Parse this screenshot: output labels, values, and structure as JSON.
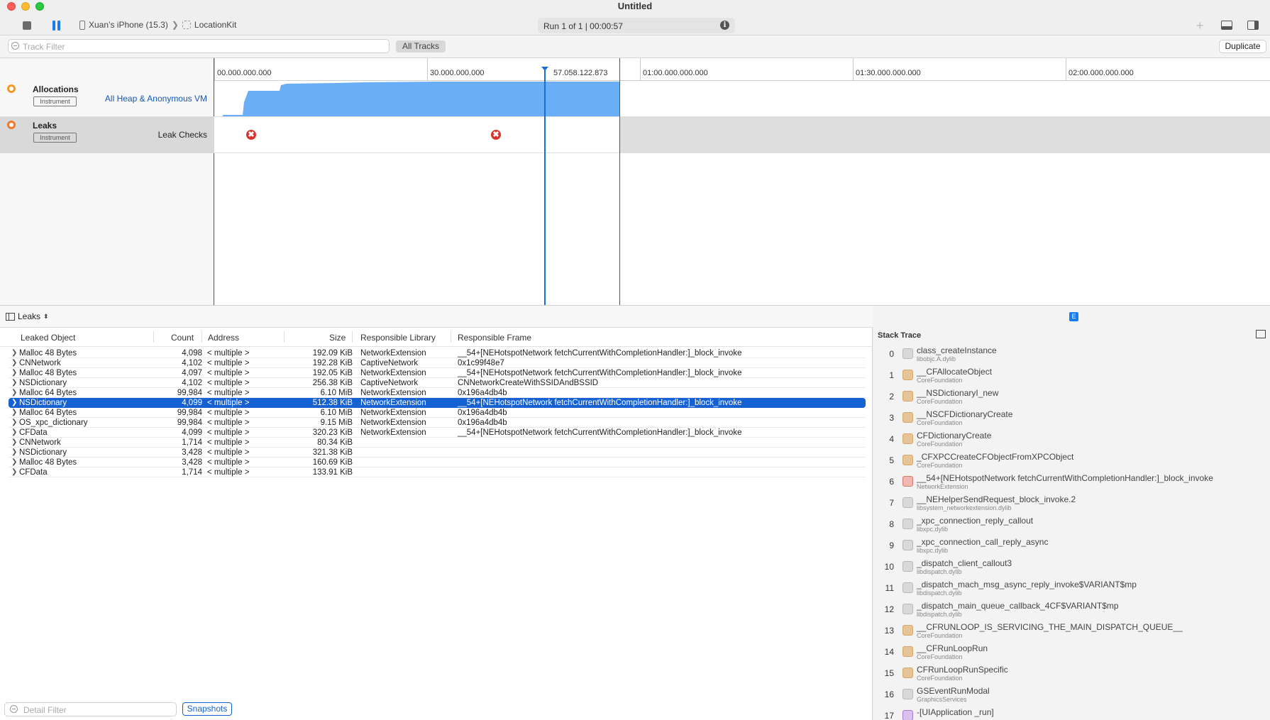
{
  "window": {
    "title": "Untitled"
  },
  "toolbar": {
    "device": "Xuan’s iPhone (15.3)",
    "app": "LocationKit",
    "run_info": "Run 1 of 1  |  00:00:57"
  },
  "filterbar": {
    "track_filter_placeholder": "Track Filter",
    "all_tracks_label": "All Tracks",
    "duplicate_label": "Duplicate"
  },
  "ruler": {
    "ticks": [
      "00.000.000.000",
      "30.000.000.000",
      "57.058.122.873",
      "01:00.000.000.000",
      "01:30.000.000.000",
      "02:00.000.000.000"
    ]
  },
  "tracks": [
    {
      "name": "Allocations",
      "badge": "Instrument",
      "subtitle": "All Heap & Anonymous VM"
    },
    {
      "name": "Leaks",
      "badge": "Instrument",
      "subtitle": "Leak Checks"
    }
  ],
  "leak_marker_glyph": "✖",
  "jumpbar": {
    "label": "Leaks"
  },
  "table": {
    "headers": {
      "object": "Leaked Object",
      "count": "Count",
      "address": "Address",
      "size": "Size",
      "library": "Responsible Library",
      "frame": "Responsible Frame"
    },
    "rows": [
      {
        "object": "Malloc 48 Bytes",
        "count": "4,098",
        "address": "< multiple >",
        "size": "192.09 KiB",
        "library": "NetworkExtension",
        "frame": "__54+[NEHotspotNetwork fetchCurrentWithCompletionHandler:]_block_invoke"
      },
      {
        "object": "CNNetwork",
        "count": "4,102",
        "address": "< multiple >",
        "size": "192.28 KiB",
        "library": "CaptiveNetwork",
        "frame": "0x1c99f48e7"
      },
      {
        "object": "Malloc 48 Bytes",
        "count": "4,097",
        "address": "< multiple >",
        "size": "192.05 KiB",
        "library": "NetworkExtension",
        "frame": "__54+[NEHotspotNetwork fetchCurrentWithCompletionHandler:]_block_invoke"
      },
      {
        "object": "NSDictionary",
        "count": "4,102",
        "address": "< multiple >",
        "size": "256.38 KiB",
        "library": "CaptiveNetwork",
        "frame": "CNNetworkCreateWithSSIDAndBSSID"
      },
      {
        "object": "Malloc 64 Bytes",
        "count": "99,984",
        "address": "< multiple >",
        "size": "6.10 MiB",
        "library": "NetworkExtension",
        "frame": "0x196a4db4b"
      },
      {
        "object": "NSDictionary",
        "count": "4,099",
        "address": "< multiple >",
        "size": "512.38 KiB",
        "library": "NetworkExtension",
        "frame": "__54+[NEHotspotNetwork fetchCurrentWithCompletionHandler:]_block_invoke"
      },
      {
        "object": "Malloc 64 Bytes",
        "count": "99,984",
        "address": "< multiple >",
        "size": "6.10 MiB",
        "library": "NetworkExtension",
        "frame": "0x196a4db4b"
      },
      {
        "object": "OS_xpc_dictionary",
        "count": "99,984",
        "address": "< multiple >",
        "size": "9.15 MiB",
        "library": "NetworkExtension",
        "frame": "0x196a4db4b"
      },
      {
        "object": "CFData",
        "count": "4,099",
        "address": "< multiple >",
        "size": "320.23 KiB",
        "library": "NetworkExtension",
        "frame": "__54+[NEHotspotNetwork fetchCurrentWithCompletionHandler:]_block_invoke"
      },
      {
        "object": "CNNetwork",
        "count": "1,714",
        "address": "< multiple >",
        "size": "80.34 KiB",
        "library": "",
        "frame": ""
      },
      {
        "object": "NSDictionary",
        "count": "3,428",
        "address": "< multiple >",
        "size": "321.38 KiB",
        "library": "",
        "frame": ""
      },
      {
        "object": "Malloc 48 Bytes",
        "count": "3,428",
        "address": "< multiple >",
        "size": "160.69 KiB",
        "library": "",
        "frame": ""
      },
      {
        "object": "CFData",
        "count": "1,714",
        "address": "< multiple >",
        "size": "133.91 KiB",
        "library": "",
        "frame": ""
      }
    ]
  },
  "detail_filter": {
    "placeholder": "Detail Filter",
    "snapshots_label": "Snapshots"
  },
  "stack_trace": {
    "badge": "E",
    "title": "Stack Trace",
    "frames": [
      {
        "num": "0",
        "name": "class_createInstance",
        "lib": "libobjc.A.dylib",
        "kind": "lib"
      },
      {
        "num": "1",
        "name": "__CFAllocateObject",
        "lib": "CoreFoundation",
        "kind": "cf"
      },
      {
        "num": "2",
        "name": "__NSDictionaryI_new",
        "lib": "CoreFoundation",
        "kind": "cf"
      },
      {
        "num": "3",
        "name": "__NSCFDictionaryCreate",
        "lib": "CoreFoundation",
        "kind": "cf"
      },
      {
        "num": "4",
        "name": "CFDictionaryCreate",
        "lib": "CoreFoundation",
        "kind": "cf"
      },
      {
        "num": "5",
        "name": "_CFXPCCreateCFObjectFromXPCObject",
        "lib": "CoreFoundation",
        "kind": "cf"
      },
      {
        "num": "6",
        "name": "__54+[NEHotspotNetwork fetchCurrentWithCompletionHandler:]_block_invoke",
        "lib": "NetworkExtension",
        "kind": "net"
      },
      {
        "num": "7",
        "name": "__NEHelperSendRequest_block_invoke.2",
        "lib": "libsystem_networkextension.dylib",
        "kind": "lib"
      },
      {
        "num": "8",
        "name": "_xpc_connection_reply_callout",
        "lib": "libxpc.dylib",
        "kind": "lib"
      },
      {
        "num": "9",
        "name": "_xpc_connection_call_reply_async",
        "lib": "libxpc.dylib",
        "kind": "lib"
      },
      {
        "num": "10",
        "name": "_dispatch_client_callout3",
        "lib": "libdispatch.dylib",
        "kind": "lib"
      },
      {
        "num": "11",
        "name": "_dispatch_mach_msg_async_reply_invoke$VARIANT$mp",
        "lib": "libdispatch.dylib",
        "kind": "lib"
      },
      {
        "num": "12",
        "name": "_dispatch_main_queue_callback_4CF$VARIANT$mp",
        "lib": "libdispatch.dylib",
        "kind": "lib"
      },
      {
        "num": "13",
        "name": "__CFRUNLOOP_IS_SERVICING_THE_MAIN_DISPATCH_QUEUE__",
        "lib": "CoreFoundation",
        "kind": "cf"
      },
      {
        "num": "14",
        "name": "__CFRunLoopRun",
        "lib": "CoreFoundation",
        "kind": "cf"
      },
      {
        "num": "15",
        "name": "CFRunLoopRunSpecific",
        "lib": "CoreFoundation",
        "kind": "cf"
      },
      {
        "num": "16",
        "name": "GSEventRunModal",
        "lib": "GraphicsServices",
        "kind": "lib"
      },
      {
        "num": "17",
        "name": "-[UIApplication _run]",
        "lib": "",
        "kind": "purple"
      }
    ]
  },
  "colors": {
    "accent": "#1561d2",
    "allocation_fill": "#6aaef7",
    "leak_marker": "#d8342c"
  }
}
